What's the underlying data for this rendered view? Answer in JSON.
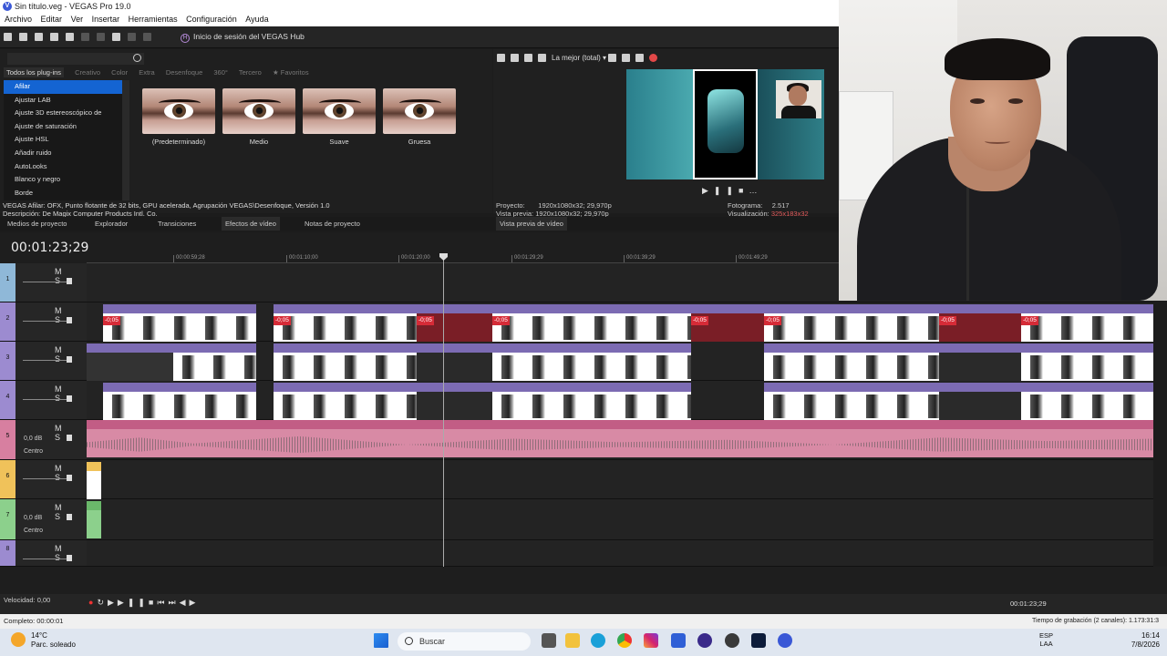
{
  "window": {
    "title": "Sin título.veg - VEGAS Pro 19.0"
  },
  "menu": [
    "Archivo",
    "Editar",
    "Ver",
    "Insertar",
    "Herramientas",
    "Configuración",
    "Ayuda"
  ],
  "toolbar": {
    "hub_label": "Inicio de sesión del VEGAS Hub"
  },
  "fx_panel": {
    "tabs": [
      "Todos los plug-ins",
      "Creativo",
      "Color",
      "Extra",
      "Desenfoque",
      "360°",
      "Tercero",
      "Favoritos"
    ],
    "plugins": [
      "Afilar",
      "Ajustar LAB",
      "Ajuste 3D estereoscópico de",
      "Ajuste de saturación",
      "Ajuste HSL",
      "Añadir ruido",
      "AutoLooks",
      "Blanco y negro",
      "Borde"
    ],
    "selected_plugin": "Afilar",
    "presets": [
      "(Predeterminado)",
      "Medio",
      "Suave",
      "Gruesa"
    ],
    "description_line1": "VEGAS Afilar: OFX, Punto flotante de 32 bits, GPU acelerada, Agrupación VEGAS\\Desenfoque, Versión 1.0",
    "description_line2": "Descripción: De Magix Computer Products Intl. Co."
  },
  "preview": {
    "quality": "La mejor (total)",
    "proyecto_label": "Proyecto:",
    "proyecto_value": "1920x1080x32; 29,970p",
    "vista_label": "Vista previa:",
    "vista_value": "1920x1080x32; 29,970p",
    "fotograma_label": "Fotograma:",
    "fotograma_value": "2.517",
    "visualizacion_label": "Visualización:",
    "visualizacion_value": "325x183x32"
  },
  "dock_tabs": [
    "Medios de proyecto",
    "Explorador",
    "Transiciones",
    "Efectos de vídeo",
    "Notas de proyecto",
    "Vista previa de vídeo"
  ],
  "timeline": {
    "timecode": "00:01:23;29",
    "ruler": [
      "00:00:59;28",
      "00:01:10;00",
      "00:01:20;00",
      "00:01:29;29",
      "00:01:39;29",
      "00:01:49;29"
    ],
    "clip_name": "memes",
    "offset_badge": "-0;05",
    "tracks": [
      {
        "num": "1",
        "type": "video",
        "color": "#8fb8d8"
      },
      {
        "num": "2",
        "type": "video",
        "color": "#9c8bd0"
      },
      {
        "num": "3",
        "type": "video",
        "color": "#9c8bd0"
      },
      {
        "num": "4",
        "type": "video",
        "color": "#9c8bd0"
      },
      {
        "num": "5",
        "type": "audio",
        "color": "#d77fa0",
        "db": "0,0 dB",
        "pan": "Centro"
      },
      {
        "num": "6",
        "type": "video",
        "color": "#f0c25a"
      },
      {
        "num": "7",
        "type": "audio",
        "color": "#8cd08c",
        "db": "0,0 dB",
        "pan": "Centro"
      },
      {
        "num": "8",
        "type": "video",
        "color": "#9c8bd0"
      }
    ],
    "ms_label": "M S"
  },
  "transport": {
    "velocidad": "Velocidad: 0,00",
    "time": "00:01:23;29"
  },
  "status": {
    "left": "Completo: 00:00:01",
    "right": "Tiempo de grabación (2 canales): 1.173:31:3"
  },
  "taskbar": {
    "temp": "14°C",
    "weather": "Parc. soleado",
    "search": "Buscar",
    "lang1": "ESP",
    "lang2": "LAA",
    "time": "16:14",
    "date": "7/8/2026"
  }
}
